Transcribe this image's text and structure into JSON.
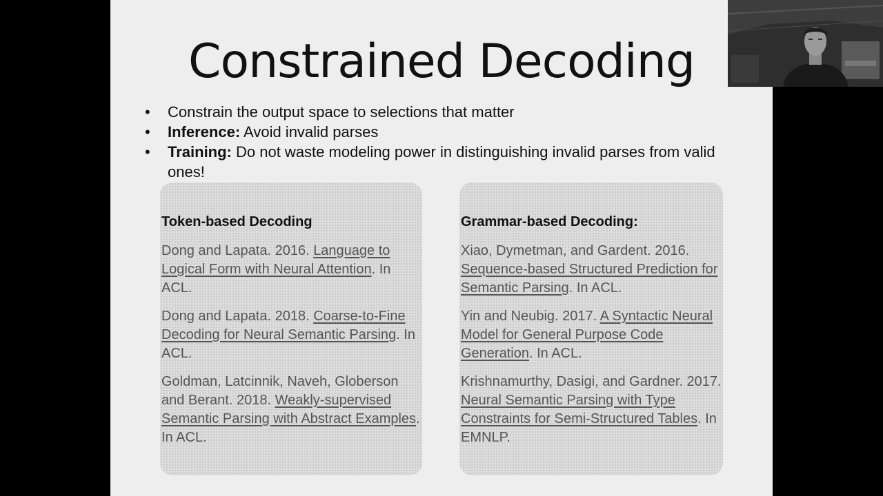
{
  "slide": {
    "title": "Constrained Decoding",
    "bullets": [
      {
        "bold": "",
        "text": "Constrain the output space to selections that matter"
      },
      {
        "bold": "Inference:",
        "text": " Avoid invalid parses"
      },
      {
        "bold": "Training:",
        "text": " Do not waste modeling power in distinguishing invalid parses from valid ones!"
      }
    ],
    "left_box": {
      "heading": "Token-based Decoding",
      "refs": [
        {
          "pre": "Dong and Lapata. 2016. ",
          "link": "Language to Logical Form with Neural Attention",
          "post": ". In ACL."
        },
        {
          "pre": "Dong and Lapata. 2018. ",
          "link": "Coarse-to-Fine Decoding for Neural Semantic Parsing",
          "post": ". In ACL."
        },
        {
          "pre": "Goldman, Latcinnik, Naveh, Globerson and Berant. 2018. ",
          "link": "Weakly-supervised Semantic Parsing with Abstract Examples",
          "post": ". In ACL."
        }
      ]
    },
    "right_box": {
      "heading": "Grammar-based Decoding:",
      "refs": [
        {
          "pre": "Xiao, Dymetman, and Gardent. 2016. ",
          "link": "Sequence-based Structured Prediction for Semantic Parsing",
          "post": ". In ACL."
        },
        {
          "pre": "Yin and Neubig. 2017. ",
          "link": "A Syntactic Neural Model for General Purpose Code Generation",
          "post": ". In ACL."
        },
        {
          "pre": "Krishnamurthy, Dasigi, and Gardner. 2017. ",
          "link": "Neural Semantic Parsing with Type Constraints for Semi-Structured Tables",
          "post": ". In EMNLP."
        }
      ]
    }
  }
}
